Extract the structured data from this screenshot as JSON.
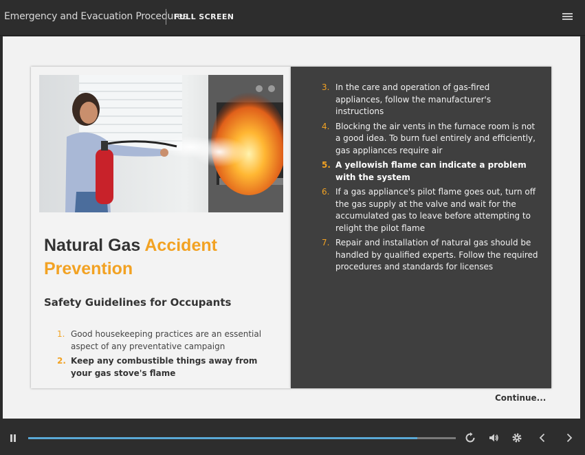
{
  "header": {
    "course_title": "Emergency and Evacuation Procedures",
    "fullscreen_label": "FULL SCREEN",
    "menu_icon": "hamburger-menu-icon"
  },
  "slide": {
    "title_part1": "Natural Gas ",
    "title_accent": "Accident Prevention",
    "subtitle": "Safety Guidelines for Occupants",
    "accent_color": "#f2a223",
    "left_items": [
      {
        "num": "1.",
        "text": "Good housekeeping practices are an essential aspect of any preventative campaign"
      },
      {
        "num": "2.",
        "text": "Keep any combustible things away from your gas stove's flame"
      }
    ],
    "right_items": [
      {
        "num": "3.",
        "text": "In the care and operation of gas-fired appliances, follow the manufacturer's instructions"
      },
      {
        "num": "4.",
        "text": "Blocking the air vents in the furnace room is not a good idea. To burn fuel entirely and efficiently, gas appliances require air"
      },
      {
        "num": "5.",
        "text": "A yellowish flame can indicate a problem with the system"
      },
      {
        "num": "6.",
        "text": "If a gas appliance's pilot flame goes out, turn off the gas supply at the valve and wait for the accumulated gas to leave before attempting to relight the pilot flame"
      },
      {
        "num": "7.",
        "text": "Repair and installation of natural gas should be handled by qualified experts. Follow the required procedures and standards for licenses"
      }
    ],
    "continue_label": "Continue..."
  },
  "player": {
    "progress": 0.91,
    "progress_color": "#5aa9d6",
    "icons": [
      "pause-icon",
      "replay-icon",
      "volume-icon",
      "settings-icon",
      "previous-icon",
      "next-icon"
    ]
  }
}
